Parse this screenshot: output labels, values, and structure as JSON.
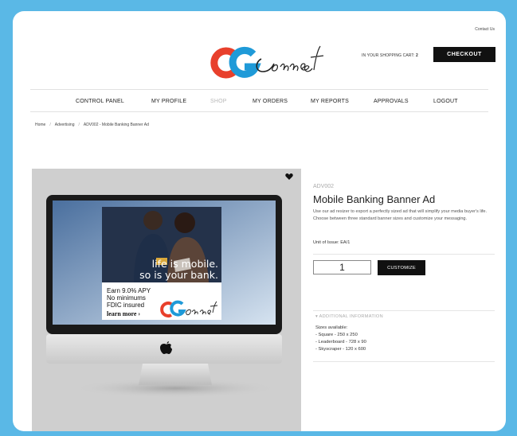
{
  "header": {
    "contact_link": "Contact Us",
    "logo_text": "CGConnect",
    "cart_label": "IN YOUR SHOPPING CART:",
    "cart_count": "2",
    "checkout_label": "CHECKOUT"
  },
  "nav": {
    "items": [
      {
        "label": "CONTROL PANEL"
      },
      {
        "label": "MY PROFILE"
      },
      {
        "label": "SHOP"
      },
      {
        "label": "MY ORDERS"
      },
      {
        "label": "MY REPORTS"
      },
      {
        "label": "APPROVALS"
      },
      {
        "label": "LOGOUT"
      }
    ]
  },
  "breadcrumb": {
    "items": [
      "Home",
      "Advertising",
      "ADV002 - Mobile Banking Banner Ad"
    ],
    "separator": "/"
  },
  "product": {
    "sku": "ADV002",
    "title": "Mobile Banking Banner Ad",
    "description": "Use our ad resizer to export a perfectly sized ad that will simplify your media buyer's life. Choose between three standard banner sizes and customize your messaging.",
    "unit_of_issue": "Unit of Issue: EA/1",
    "quantity": "1",
    "customize_label": "CUSTOMIZE",
    "additional_info_label": "ADDITIONAL INFORMATION",
    "sizes_heading": "Sizes available:",
    "sizes": [
      "- Square - 250 x 250",
      "- Leaderboard - 728 x 90",
      "- Skyscraper - 120 x 600"
    ]
  },
  "banner": {
    "headline_1": "life is mobile.",
    "headline_2": "so is your bank.",
    "line_1": "Earn 9.0% APY",
    "line_2": "No minimums",
    "line_3": "FDIC insured",
    "cta": "learn more ›",
    "logo": "CGConnect"
  },
  "colors": {
    "brand_red": "#e8402c",
    "brand_blue": "#1f9ad8",
    "background": "#5ab8e6",
    "button_dark": "#111111"
  },
  "icons": {
    "favorite": "heart-icon",
    "expand": "chevron-down-icon",
    "apple": "apple-logo-icon"
  }
}
